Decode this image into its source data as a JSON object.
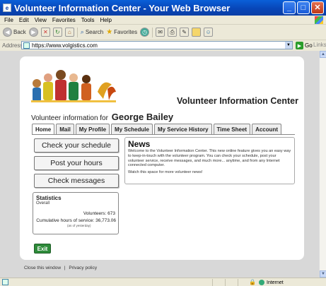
{
  "window": {
    "title": "Volunteer Information Center - Your Web Browser",
    "minimize": "_",
    "maximize": "□",
    "close": "✕"
  },
  "menu": {
    "items": [
      "File",
      "Edit",
      "View",
      "Favorites",
      "Tools",
      "Help"
    ]
  },
  "toolbar": {
    "back": "Back",
    "search": "Search",
    "favorites": "Favorites"
  },
  "address": {
    "label": "Address",
    "url": "https://www.volgistics.com",
    "go": "Go",
    "links": "Links"
  },
  "page": {
    "header_title": "Volunteer Information Center",
    "volunteer_info_label": "Volunteer information for",
    "volunteer_name": "George Bailey",
    "tabs": [
      "Home",
      "Mail",
      "My Profile",
      "My Schedule",
      "My Service History",
      "Time Sheet",
      "Account"
    ],
    "active_tab": "Home",
    "buttons": {
      "check_schedule": "Check your schedule",
      "post_hours": "Post your hours",
      "check_messages": "Check messages",
      "exit": "Exit"
    },
    "stats": {
      "title": "Statistics",
      "subtitle": "Overall",
      "volunteers": "Volunteers: 673",
      "cumulative": "Cumulative hours of service: 36,773.06",
      "as_of": "(as of yesterday)"
    },
    "news": {
      "title": "News",
      "body": "Welcome to the Volunteer Information Center. This new online feature gives you an easy way to keep-in-touch with the volunteer program. You can check your schedule, post your volunteer service, receive messages, and much more... anytime, and from any Internet connected computer.",
      "watch": "Watch this space for more volunteer news!"
    },
    "footer": {
      "close_window": "Close this window",
      "divider": "|",
      "privacy": "Privacy policy"
    }
  },
  "status": {
    "zone": "Internet"
  },
  "colors": {
    "titlebar": "#0846b8",
    "exit_button": "#2e8b3a",
    "page_bg": "#ffffff",
    "viewport_bg": "#d8d8d8"
  }
}
